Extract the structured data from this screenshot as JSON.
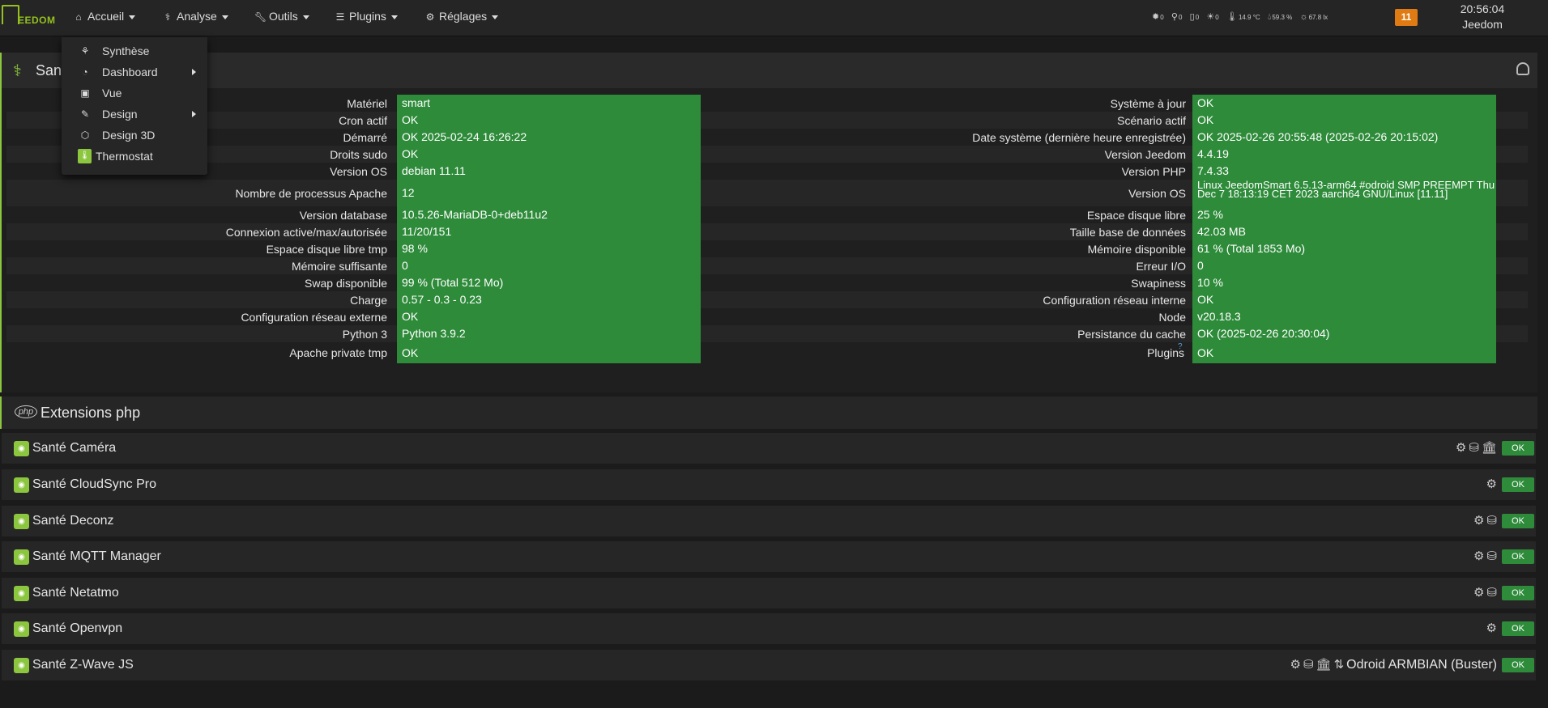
{
  "header": {
    "logo_text": "EEDOM",
    "menus": [
      {
        "label": "Accueil",
        "icon": "home-icon"
      },
      {
        "label": "Analyse",
        "icon": "analysis-icon"
      },
      {
        "label": "Outils",
        "icon": "wrench-icon"
      },
      {
        "label": "Plugins",
        "icon": "list-icon"
      },
      {
        "label": "Réglages",
        "icon": "gear-icon"
      }
    ],
    "sensors": [
      {
        "icon": "light-icon",
        "value": "0"
      },
      {
        "icon": "motion-icon",
        "value": "0"
      },
      {
        "icon": "door-icon",
        "value": "0"
      },
      {
        "icon": "light-bulb-icon",
        "value": "0"
      },
      {
        "icon": "thermometer-icon",
        "value": "14.9 °C"
      },
      {
        "icon": "humidity-icon",
        "value": "59.3 %"
      },
      {
        "icon": "luminosity-icon",
        "value": "67.8 lx"
      }
    ],
    "notification_count": "11",
    "time": "20:56:04",
    "user": "Jeedom"
  },
  "dropdown": {
    "items": [
      {
        "label": "Synthèse",
        "icon": "synthesis-icon"
      },
      {
        "label": "Dashboard",
        "icon": "dashboard-icon"
      },
      {
        "label": "Vue",
        "icon": "picture-icon"
      },
      {
        "label": "Design",
        "icon": "brush-icon"
      },
      {
        "label": "Design 3D",
        "icon": "cubes-icon"
      },
      {
        "label": "Thermostat",
        "icon": "thermostat-icon"
      }
    ]
  },
  "health": {
    "title": "Sant",
    "left": [
      {
        "label": "Matériel",
        "value": "smart"
      },
      {
        "label": "Cron actif",
        "value": "OK"
      },
      {
        "label": "Démarré",
        "value": "OK 2025-02-24 16:26:22"
      },
      {
        "label": "Droits sudo",
        "value": "OK"
      },
      {
        "label": "Version OS",
        "value": "debian 11.11"
      },
      {
        "label": "Nombre de processus Apache",
        "value": "12"
      },
      {
        "label": "Version database",
        "value": "10.5.26-MariaDB-0+deb11u2"
      },
      {
        "label": "Connexion active/max/autorisée",
        "value": "11/20/151"
      },
      {
        "label": "Espace disque libre tmp",
        "value": "98 %"
      },
      {
        "label": "Mémoire suffisante",
        "value": "0"
      },
      {
        "label": "Swap disponible",
        "value": "99 % (Total 512 Mo)"
      },
      {
        "label": "Charge",
        "value": "0.57 - 0.3 - 0.23"
      },
      {
        "label": "Configuration réseau externe",
        "value": "OK"
      },
      {
        "label": "Python 3",
        "value": "Python 3.9.2"
      },
      {
        "label": "Apache private tmp",
        "value": "OK"
      }
    ],
    "right": [
      {
        "label": "Système à jour",
        "value": "OK"
      },
      {
        "label": "Scénario actif",
        "value": "OK"
      },
      {
        "label": "Date système (dernière heure enregistrée)",
        "value": "OK 2025-02-26 20:55:48 (2025-02-26 20:15:02)"
      },
      {
        "label": "Version Jeedom",
        "value": "4.4.19"
      },
      {
        "label": "Version PHP",
        "value": "7.4.33"
      },
      {
        "label": "Version OS",
        "value": "Linux JeedomSmart 6.5.13-arm64 #odroid SMP PREEMPT Thu Dec 7 18:13:19 CET 2023 aarch64 GNU/Linux [11.11]"
      },
      {
        "label": "Espace disque libre",
        "value": "25 %"
      },
      {
        "label": "Taille base de données",
        "value": "42.03 MB"
      },
      {
        "label": "Mémoire disponible",
        "value": "61 % (Total 1853 Mo)"
      },
      {
        "label": "Erreur I/O",
        "value": "0"
      },
      {
        "label": "Swapiness",
        "value": "10 %"
      },
      {
        "label": "Configuration réseau interne",
        "value": "OK"
      },
      {
        "label": "Node",
        "value": "v20.18.3"
      },
      {
        "label": "Persistance du cache",
        "value": "OK (2025-02-26 20:30:04)"
      },
      {
        "label": "Plugins",
        "value": "OK"
      }
    ]
  },
  "extensions": {
    "title": "Extensions php",
    "icon_text": "php"
  },
  "plugins": [
    {
      "title": "Santé Caméra",
      "status": "OK",
      "icons": [
        "cogs-icon",
        "backup-icon",
        "institution-icon"
      ],
      "extra": ""
    },
    {
      "title": "Santé CloudSync Pro",
      "status": "OK",
      "icons": [
        "cogs-icon"
      ],
      "extra": ""
    },
    {
      "title": "Santé Deconz",
      "status": "OK",
      "icons": [
        "cogs-icon",
        "backup-icon"
      ],
      "extra": ""
    },
    {
      "title": "Santé MQTT Manager",
      "status": "OK",
      "icons": [
        "cogs-icon",
        "backup-icon"
      ],
      "extra": ""
    },
    {
      "title": "Santé Netatmo",
      "status": "OK",
      "icons": [
        "cogs-icon",
        "backup-icon"
      ],
      "extra": ""
    },
    {
      "title": "Santé Openvpn",
      "status": "OK",
      "icons": [
        "cogs-icon"
      ],
      "extra": ""
    },
    {
      "title": "Santé Z-Wave JS",
      "status": "OK",
      "icons": [
        "cogs-icon",
        "backup-icon",
        "institution-icon",
        "sort-icon"
      ],
      "extra": "Odroid ARMBIAN (Buster)"
    }
  ],
  "colors": {
    "accent": "#8cc63f",
    "ok_bg": "#2e8b3a",
    "badge": "#e07b14"
  }
}
